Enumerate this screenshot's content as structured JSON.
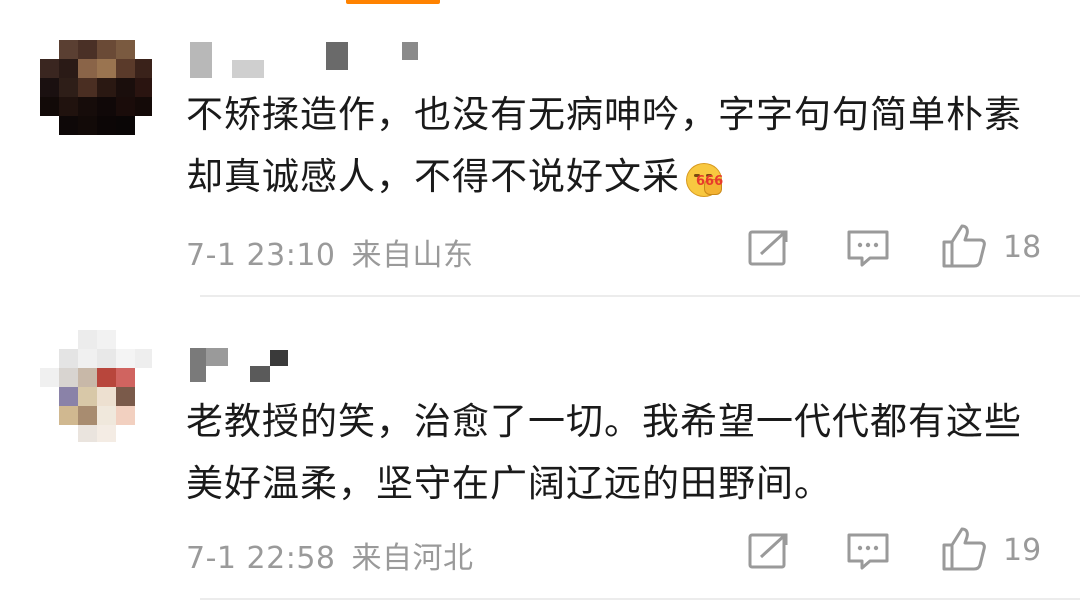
{
  "tab_indicator_color": "#ff8200",
  "comments": [
    {
      "text": "不矫揉造作，也没有无病呻吟，字字句句简单朴素却真诚感人，不得不说好文采",
      "emoji": "666-icon",
      "emoji_text": "666",
      "time": "7-1 23:10",
      "location": "来自山东",
      "like_count": "18"
    },
    {
      "text": "老教授的笑，治愈了一切。我希望一代代都有这些美好温柔，坚守在广阔辽远的田野间。",
      "time": "7-1 22:58",
      "location": "来自河北",
      "like_count": "19"
    }
  ]
}
